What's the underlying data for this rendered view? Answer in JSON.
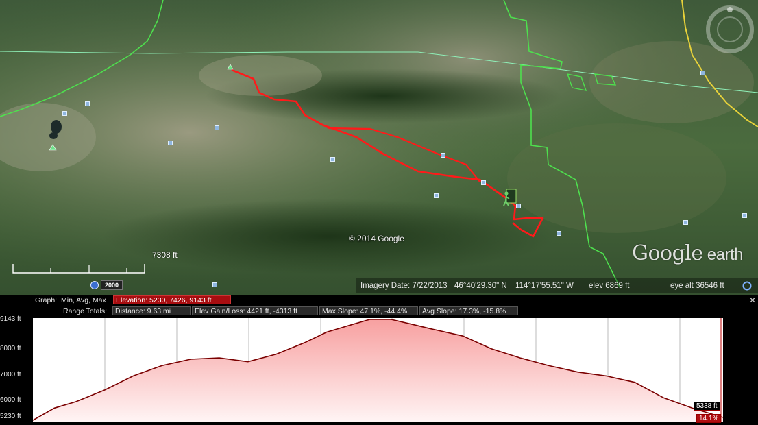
{
  "map": {
    "copyright": "© 2014 Google",
    "brand_main": "Google",
    "brand_sub": " earth",
    "scale_label": "7308 ft",
    "historical_year": "2000",
    "status": {
      "imagery_date": "Imagery Date: 7/22/2013",
      "lat": "46°40'29.30\" N",
      "lon": "114°17'55.51\" W",
      "elev": "elev  6869 ft",
      "eye_alt": "eye alt  36546 ft"
    },
    "icons": {
      "hiker": "hiker-icon",
      "start": "trailhead-icon",
      "nav": "compass-ring-icon",
      "streaming": "streaming-icon"
    },
    "colors": {
      "track": "#ff1a1a",
      "boundary": "#44dd44",
      "road": "#e8d23a"
    }
  },
  "profile": {
    "graph_label": "Graph:",
    "graph_value": "Min, Avg, Max",
    "elevation_stat": "Elevation: 5230, 7426, 9143 ft",
    "range_label": "Range Totals:",
    "distance": "Distance: 9.63 mi",
    "gain_loss": "Elev Gain/Loss: 4421 ft, -4313 ft",
    "max_slope": "Max Slope: 47.1%, -44.4%",
    "avg_slope": "Avg Slope: 17.3%, -15.8%",
    "close": "✕",
    "cursor_elev": "5338 ft",
    "cursor_slope": "14.1%"
  },
  "chart_data": {
    "type": "area",
    "ylim": [
      5230,
      9143
    ],
    "xlim": [
      0,
      9.63
    ],
    "y_ticks": [
      "9143 ft",
      "8000 ft",
      "7000 ft",
      "6000 ft",
      "5230 ft"
    ],
    "y_tick_values": [
      9143,
      8000,
      7000,
      6000,
      5230
    ],
    "series": [
      {
        "x": [
          0,
          0.3,
          0.6,
          1.0,
          1.4,
          1.8,
          2.2,
          2.6,
          3.0,
          3.4,
          3.8,
          4.1,
          4.4,
          4.7,
          5.0,
          5.3,
          5.6,
          6.0,
          6.4,
          6.8,
          7.2,
          7.6,
          8.0,
          8.4,
          8.8,
          9.2,
          9.63
        ],
        "y": [
          5230,
          5700,
          5950,
          6400,
          6950,
          7350,
          7600,
          7650,
          7500,
          7800,
          8250,
          8650,
          8900,
          9143,
          9143,
          8950,
          8750,
          8500,
          8000,
          7650,
          7350,
          7100,
          6950,
          6700,
          6100,
          5700,
          5338
        ]
      }
    ],
    "colors": {
      "line": "#7a0000",
      "fill_top": "#f7a0a0",
      "fill_bottom": "#ffffff",
      "grid": "#bbbbbb"
    }
  }
}
